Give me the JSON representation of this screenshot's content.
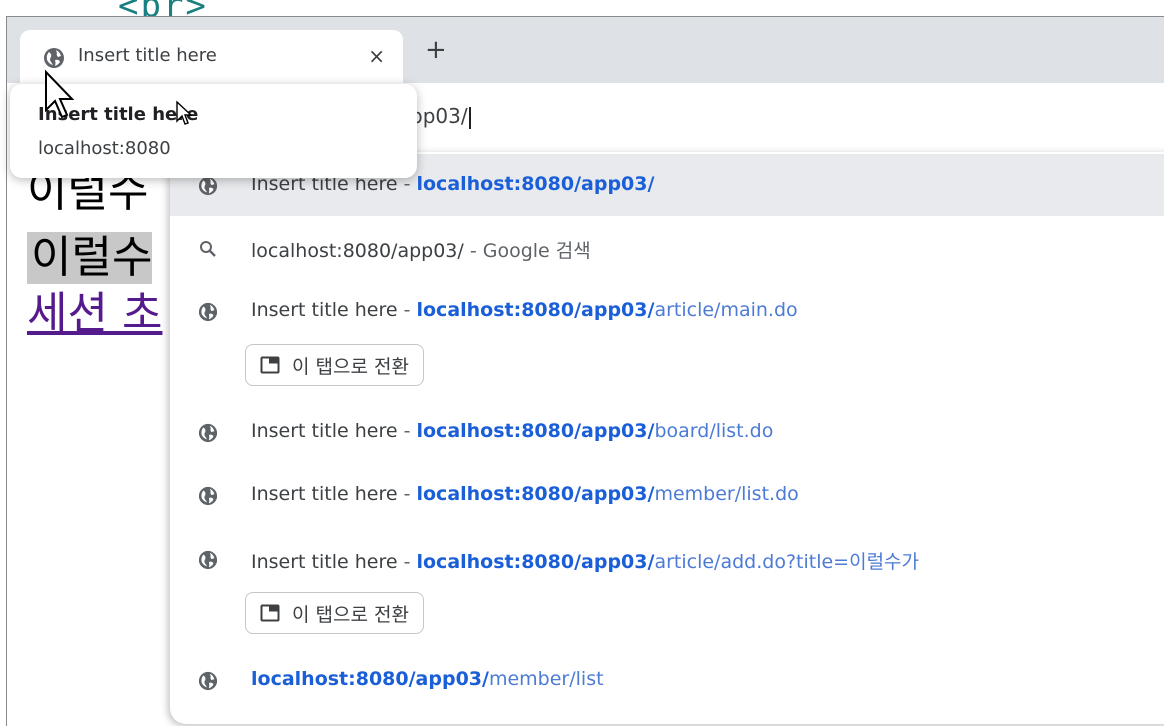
{
  "background": {
    "code_text": "<br>"
  },
  "tab": {
    "title": "Insert title here",
    "close": "×",
    "new_tab": "+",
    "icon": "globe-icon"
  },
  "page": {
    "line1": "이럴수",
    "line2": "이럴수",
    "line3": "세션 초"
  },
  "omnibox": {
    "text": "pp03/"
  },
  "tooltip": {
    "title": "Insert title here",
    "subtitle": "localhost:8080"
  },
  "suggestions": [
    {
      "icon": "globe-icon",
      "title": "Insert title here",
      "sep": " - ",
      "host": "localhost:8080/app03/",
      "path": "",
      "selected": true
    },
    {
      "icon": "search-icon",
      "query": "localhost:8080/app03/",
      "sep": " - ",
      "engine": "Google 검색"
    },
    {
      "icon": "globe-icon",
      "title": "Insert title here",
      "sep": " - ",
      "host": "localhost:8080/app03/",
      "path": "article/main.do",
      "switch_label": "이 탭으로 전환"
    },
    {
      "icon": "globe-icon",
      "title": "Insert title here",
      "sep": " - ",
      "host": "localhost:8080/app03/",
      "path": "board/list.do"
    },
    {
      "icon": "globe-icon",
      "title": "Insert title here",
      "sep": " - ",
      "host": "localhost:8080/app03/",
      "path": "member/list.do"
    },
    {
      "icon": "globe-icon",
      "title": "Insert title here",
      "sep": " - ",
      "host": "localhost:8080/app03/",
      "path": "article/add.do?title=이럴수가",
      "switch_label": "이 탭으로 전환"
    },
    {
      "icon": "globe-icon",
      "host": "localhost:8080/app03/",
      "path": "member/list"
    }
  ],
  "colors": {
    "highlight": "#1a5ed8",
    "url": "#4c7bd6",
    "selected_row": "#e8eaed",
    "tabstrip": "#dee1e6"
  }
}
